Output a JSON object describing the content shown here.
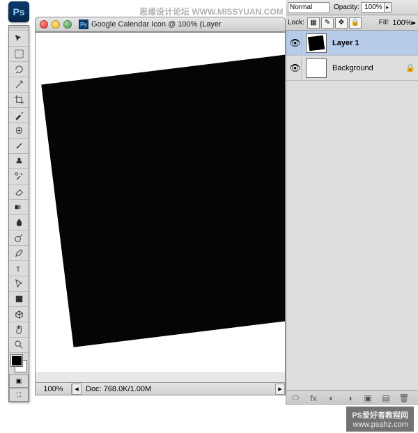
{
  "app": {
    "logo_text": "Ps"
  },
  "window": {
    "title": "Google Calendar Icon @ 100% (Layer"
  },
  "options": {
    "blend_mode": "Normal",
    "opacity_label": "Opacity:",
    "opacity_value": "100%",
    "lock_label": "Lock:",
    "fill_label": "Fill:",
    "fill_value": "100%"
  },
  "status": {
    "zoom": "100%",
    "doc_label": "Doc:",
    "doc_value": "768.0K/1.00M"
  },
  "layers": {
    "items": [
      {
        "name": "Layer 1",
        "visible": true,
        "selected": true,
        "thumb": "black",
        "locked": false
      },
      {
        "name": "Background",
        "visible": true,
        "selected": false,
        "thumb": "white",
        "locked": true
      }
    ],
    "footer_icons": [
      "fx-icon",
      "mask-icon",
      "folder-icon",
      "adjust-icon",
      "new-layer-icon",
      "trash-icon"
    ]
  },
  "tools": [
    "move-tool",
    "marquee-tool",
    "lasso-tool",
    "wand-tool",
    "crop-tool",
    "eyedropper-tool",
    "healing-tool",
    "brush-tool",
    "stamp-tool",
    "history-brush-tool",
    "eraser-tool",
    "gradient-tool",
    "blur-tool",
    "dodge-tool",
    "pen-tool",
    "type-tool",
    "path-select-tool",
    "shape-tool",
    "3d-tool",
    "hand-tool",
    "zoom-tool"
  ],
  "watermarks": {
    "top": "思缘设计论坛  WWW.MISSYUAN.COM",
    "bottom_cn": "PS爱好者教程网",
    "bottom_url": "www.psahz.com"
  }
}
